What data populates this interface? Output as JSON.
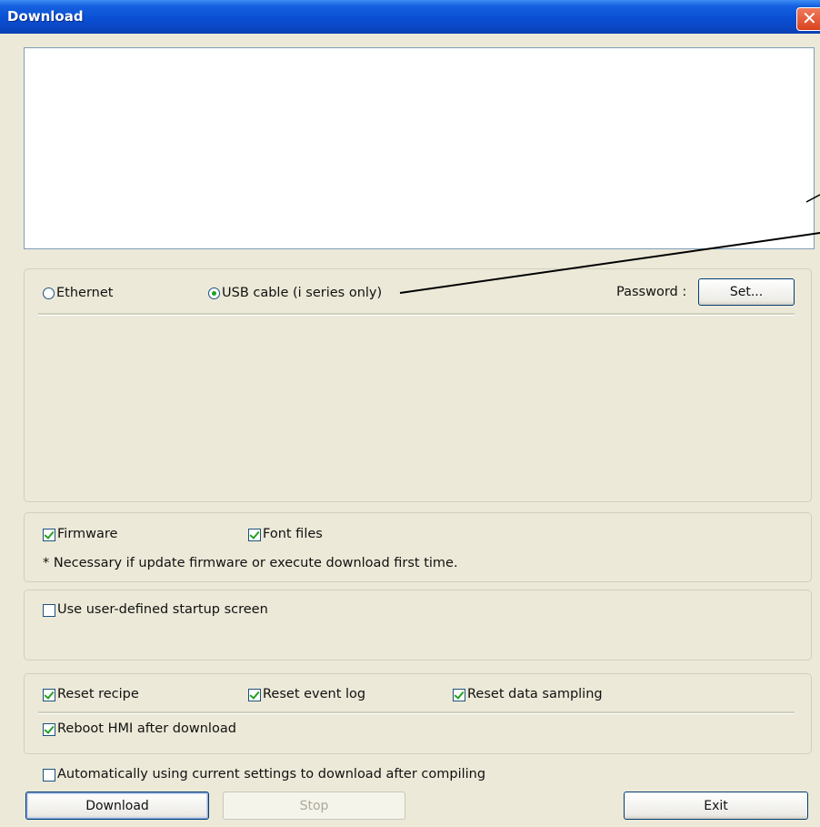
{
  "window": {
    "title": "Download"
  },
  "connection": {
    "ethernet_label": "Ethernet",
    "usb_label": "USB cable (i series only)",
    "selected": "usb",
    "password_label": "Password :",
    "set_button": "Set..."
  },
  "files": {
    "firmware_label": "Firmware",
    "firmware_checked": true,
    "font_files_label": "Font files",
    "font_files_checked": true,
    "note": "* Necessary if update firmware or execute download first time."
  },
  "startup": {
    "label": "Use user-defined startup screen",
    "checked": false
  },
  "reset": {
    "recipe_label": "Reset recipe",
    "event_log_label": "Reset event log",
    "data_sampling_label": "Reset data sampling",
    "reboot_label": "Reboot HMI after download"
  },
  "auto": {
    "label": "Automatically using current settings to download after compiling",
    "checked": false
  },
  "buttons": {
    "download": "Download",
    "stop": "Stop",
    "exit": "Exit"
  },
  "colors": {
    "title_bar": "#0a4fd3",
    "dialog_bg": "#ece9d8",
    "check_mark": "#21a121"
  }
}
